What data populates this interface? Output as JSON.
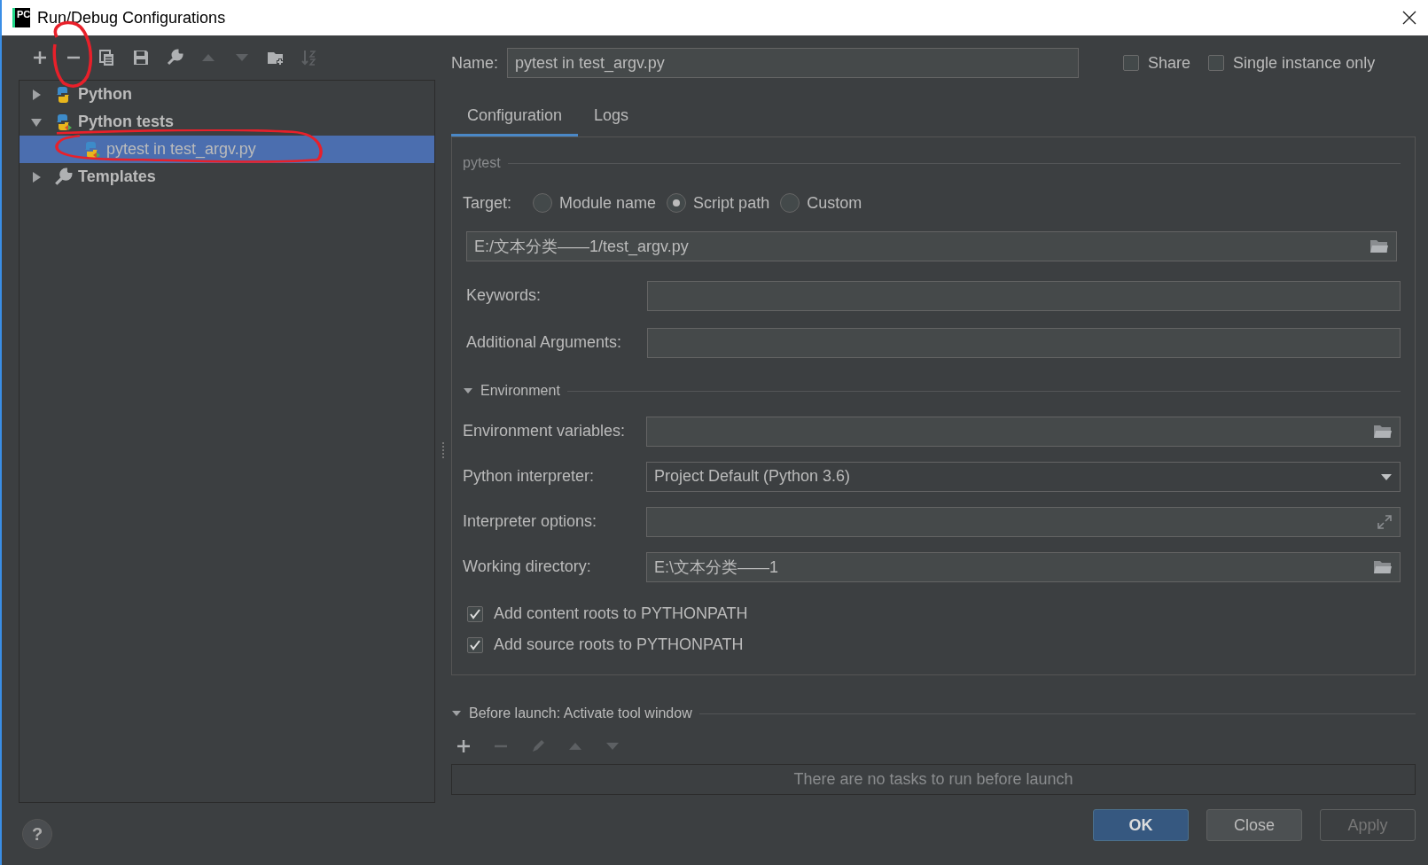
{
  "window": {
    "title": "Run/Debug Configurations",
    "logo_text": "PC"
  },
  "toolbar": [
    {
      "kind": "add",
      "disabled": false
    },
    {
      "kind": "remove",
      "disabled": false
    },
    {
      "kind": "copy",
      "disabled": false
    },
    {
      "kind": "save",
      "disabled": false
    },
    {
      "kind": "wrench",
      "disabled": false
    },
    {
      "kind": "up",
      "disabled": true
    },
    {
      "kind": "down",
      "disabled": true
    },
    {
      "kind": "folder",
      "disabled": false
    },
    {
      "kind": "sort",
      "disabled": true
    }
  ],
  "tree": [
    {
      "label": "Python",
      "kind": "python",
      "expanded": false,
      "selected": false
    },
    {
      "label": "Python tests",
      "kind": "python-test",
      "expanded": true,
      "selected": false,
      "children": [
        {
          "label": "pytest in test_argv.py",
          "kind": "python-test",
          "selected": true
        }
      ]
    },
    {
      "label": "Templates",
      "kind": "wrench",
      "expanded": false,
      "selected": false
    }
  ],
  "name_field": {
    "label": "Name:",
    "value": "pytest in test_argv.py"
  },
  "options": [
    {
      "label": "Share",
      "checked": false
    },
    {
      "label": "Single instance only",
      "checked": false
    }
  ],
  "tabs": [
    {
      "label": "Configuration",
      "selected": true
    },
    {
      "label": "Logs",
      "selected": false
    }
  ],
  "section_title": "pytest",
  "target": {
    "label": "Target:",
    "options": [
      {
        "label": "Module name",
        "selected": false
      },
      {
        "label": "Script path",
        "selected": true
      },
      {
        "label": "Custom",
        "selected": false
      }
    ]
  },
  "script_path": {
    "value": "E:/文本分类——1/test_argv.py",
    "kind": "folder"
  },
  "fields": [
    {
      "label": "Keywords:"
    },
    {
      "label": "Additional Arguments:"
    }
  ],
  "environment": {
    "title": "Environment",
    "expanded": true,
    "fields": [
      {
        "label": "Environment variables:",
        "kind": "folder"
      },
      {
        "label": "Python interpreter:",
        "kind": "dropdown",
        "value": "Project Default (Python 3.6)"
      },
      {
        "label": "Interpreter options:",
        "kind": "expand"
      },
      {
        "label": "Working directory:",
        "kind": "folder",
        "value": "E:\\文本分类——1"
      }
    ]
  },
  "checkboxes": [
    {
      "label": "Add content roots to PYTHONPATH",
      "checked": true
    },
    {
      "label": "Add source roots to PYTHONPATH",
      "checked": true
    }
  ],
  "before_launch": {
    "title": "Before launch: Activate tool window",
    "expanded": true,
    "toolbar": [
      {
        "kind": "add",
        "disabled": false
      },
      {
        "kind": "remove",
        "disabled": true
      },
      {
        "kind": "edit",
        "disabled": true
      },
      {
        "kind": "up",
        "disabled": true
      },
      {
        "kind": "down",
        "disabled": true
      }
    ],
    "empty_text": "There are no tasks to run before launch"
  },
  "help": "?",
  "buttons": [
    {
      "label": "OK",
      "default": true,
      "disabled": false
    },
    {
      "label": "Close",
      "default": false,
      "disabled": false
    },
    {
      "label": "Apply",
      "default": false,
      "disabled": true
    }
  ]
}
